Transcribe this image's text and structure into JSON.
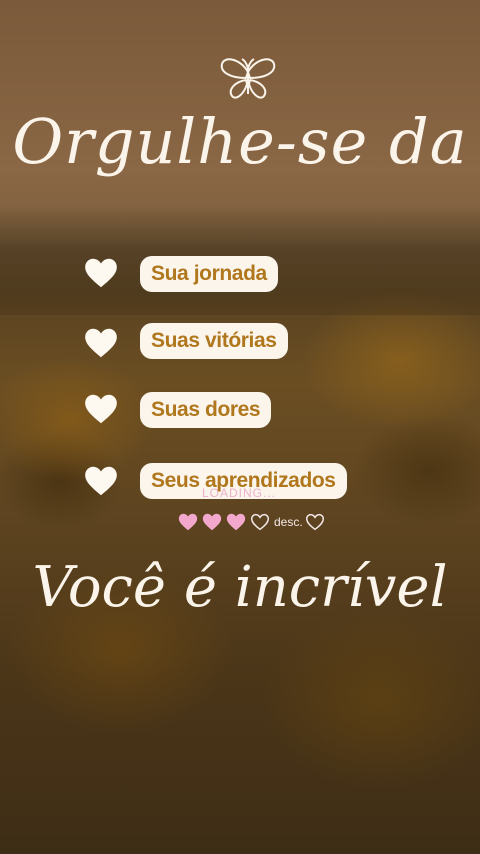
{
  "title": "Orgulhe-se da",
  "items": [
    {
      "label": "Sua jornada"
    },
    {
      "label": "Suas vitórias"
    },
    {
      "label": "Suas dores"
    },
    {
      "label": "Seus aprendizados"
    }
  ],
  "loading": {
    "text": "LOADING...",
    "desc": "desc.",
    "filled_hearts": 3,
    "total_hearts": 4
  },
  "subtitle": "Você é incrível",
  "colors": {
    "pill_text": "#b0771c",
    "pill_bg": "#fbf5ec",
    "text": "#fbf4ea",
    "pink": "#f2a7cc"
  },
  "icons": {
    "top": "butterfly-icon",
    "bullet": "heart-icon"
  }
}
